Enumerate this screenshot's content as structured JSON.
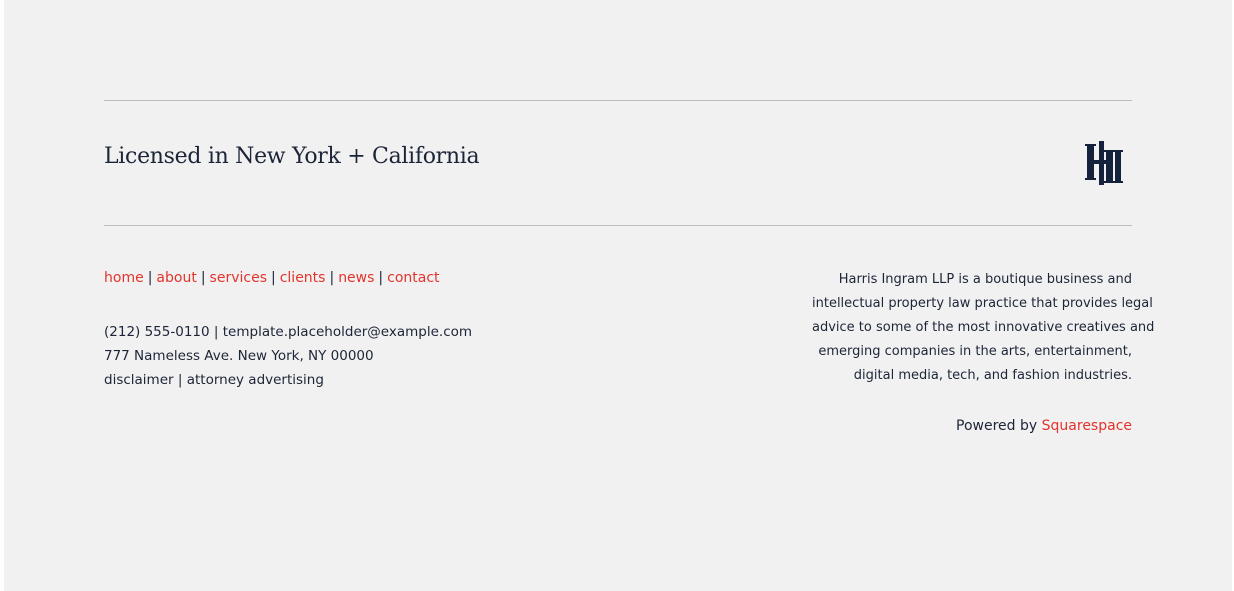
{
  "license": "Licensed in New York + California",
  "logo": {
    "icon": "hi-monogram-icon",
    "color": "#15223b"
  },
  "nav": {
    "items": [
      {
        "label": "home"
      },
      {
        "label": "about"
      },
      {
        "label": "services"
      },
      {
        "label": "clients"
      },
      {
        "label": "news"
      },
      {
        "label": "contact"
      }
    ],
    "separator": "|"
  },
  "contact": {
    "phone": "(212) 555-0110",
    "separator": "|",
    "email": "template.placeholder@example.com",
    "address": "777 Nameless Ave. New York, NY 00000",
    "disclaimer": "disclaimer",
    "attorney_advertising": "attorney advertising"
  },
  "about": {
    "lines": [
      "Harris Ingram LLP is a boutique business and",
      "intellectual property law practice that provides legal",
      "advice to some of the most innovative creatives and",
      "emerging companies in the arts, entertainment,",
      "digital media, tech, and fashion industries."
    ]
  },
  "powered": {
    "prefix": "Powered by",
    "link": "Squarespace"
  },
  "colors": {
    "accent": "#e2342c",
    "text": "#1c2537",
    "background": "#f2f1f2",
    "rule": "#bfbcbe"
  }
}
